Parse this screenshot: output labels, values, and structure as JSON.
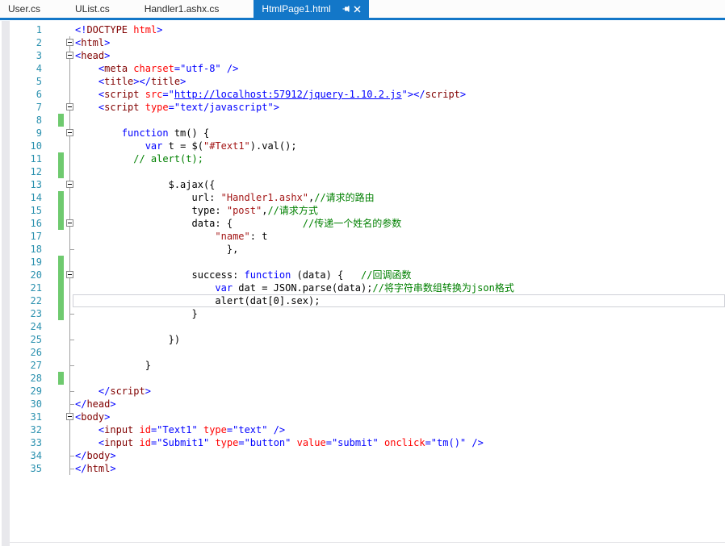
{
  "window": {
    "title": "HtmlPage1.html"
  },
  "colors": {
    "accent": "#1377c8",
    "line_number": "#2b91af",
    "change_bar": "#6fca6f",
    "comment": "#008000",
    "element": "#800000",
    "attribute": "#ff0000",
    "value": "#0000ff",
    "string": "#a31515"
  },
  "tabs": [
    {
      "label": "User.cs",
      "active": false
    },
    {
      "label": "UList.cs",
      "active": false
    },
    {
      "label": "Handler1.ashx.cs",
      "active": false
    },
    {
      "label": "HtmlPage1.html",
      "active": true,
      "icons": [
        "pin-icon",
        "close-icon"
      ]
    }
  ],
  "editor": {
    "current_line": 22,
    "lines": [
      {
        "n": 1,
        "chg": false,
        "fold": "",
        "tokens": [
          [
            "d",
            "<!"
          ],
          [
            "e",
            "DOCTYPE"
          ],
          [
            "t",
            " "
          ],
          [
            "a",
            "html"
          ],
          [
            "d",
            ">"
          ]
        ]
      },
      {
        "n": 2,
        "chg": false,
        "fold": "box",
        "tokens": [
          [
            "d",
            "<"
          ],
          [
            "e",
            "html"
          ],
          [
            "d",
            ">"
          ]
        ]
      },
      {
        "n": 3,
        "chg": false,
        "fold": "box",
        "tokens": [
          [
            "d",
            "<"
          ],
          [
            "e",
            "head"
          ],
          [
            "d",
            ">"
          ]
        ]
      },
      {
        "n": 4,
        "chg": false,
        "fold": "vline",
        "tokens": [
          [
            "t",
            "    "
          ],
          [
            "d",
            "<"
          ],
          [
            "e",
            "meta"
          ],
          [
            "t",
            " "
          ],
          [
            "a",
            "charset"
          ],
          [
            "v",
            "=\"utf-8\""
          ],
          [
            "t",
            " "
          ],
          [
            "d",
            "/>"
          ]
        ]
      },
      {
        "n": 5,
        "chg": false,
        "fold": "vline",
        "tokens": [
          [
            "t",
            "    "
          ],
          [
            "d",
            "<"
          ],
          [
            "e",
            "title"
          ],
          [
            "d",
            "></"
          ],
          [
            "e",
            "title"
          ],
          [
            "d",
            ">"
          ]
        ]
      },
      {
        "n": 6,
        "chg": false,
        "fold": "vline",
        "tokens": [
          [
            "t",
            "    "
          ],
          [
            "d",
            "<"
          ],
          [
            "e",
            "script"
          ],
          [
            "t",
            " "
          ],
          [
            "a",
            "src"
          ],
          [
            "v",
            "=\""
          ],
          [
            "u",
            "http://localhost:57912/jquery-1.10.2.js"
          ],
          [
            "v",
            "\""
          ],
          [
            "d",
            "></"
          ],
          [
            "e",
            "script"
          ],
          [
            "d",
            ">"
          ]
        ]
      },
      {
        "n": 7,
        "chg": false,
        "fold": "box",
        "tokens": [
          [
            "t",
            "    "
          ],
          [
            "d",
            "<"
          ],
          [
            "e",
            "script"
          ],
          [
            "t",
            " "
          ],
          [
            "a",
            "type"
          ],
          [
            "v",
            "=\"text/javascript\""
          ],
          [
            "d",
            ">"
          ]
        ]
      },
      {
        "n": 8,
        "chg": true,
        "fold": "vline",
        "tokens": []
      },
      {
        "n": 9,
        "chg": false,
        "fold": "box",
        "tokens": [
          [
            "t",
            "        "
          ],
          [
            "k",
            "function"
          ],
          [
            "t",
            " tm() {"
          ]
        ]
      },
      {
        "n": 10,
        "chg": false,
        "fold": "vline",
        "tokens": [
          [
            "t",
            "            "
          ],
          [
            "k",
            "var"
          ],
          [
            "t",
            " t = $("
          ],
          [
            "s",
            "\"#Text1\""
          ],
          [
            "t",
            ").val();"
          ]
        ]
      },
      {
        "n": 11,
        "chg": true,
        "fold": "vline",
        "tokens": [
          [
            "t",
            "          "
          ],
          [
            "c",
            "// alert(t);"
          ]
        ]
      },
      {
        "n": 12,
        "chg": true,
        "fold": "vline",
        "tokens": []
      },
      {
        "n": 13,
        "chg": false,
        "fold": "box",
        "tokens": [
          [
            "t",
            "                $.ajax({"
          ]
        ]
      },
      {
        "n": 14,
        "chg": true,
        "fold": "vline",
        "tokens": [
          [
            "t",
            "                    url: "
          ],
          [
            "s",
            "\"Handler1.ashx\""
          ],
          [
            "t",
            ","
          ],
          [
            "c",
            "//请求的路由"
          ]
        ]
      },
      {
        "n": 15,
        "chg": true,
        "fold": "vline",
        "tokens": [
          [
            "t",
            "                    type: "
          ],
          [
            "s",
            "\"post\""
          ],
          [
            "t",
            ","
          ],
          [
            "c",
            "//请求方式"
          ]
        ]
      },
      {
        "n": 16,
        "chg": true,
        "fold": "box",
        "tokens": [
          [
            "t",
            "                    data: {            "
          ],
          [
            "c",
            "//传递一个姓名的参数"
          ]
        ]
      },
      {
        "n": 17,
        "chg": false,
        "fold": "vline",
        "tokens": [
          [
            "t",
            "                        "
          ],
          [
            "s",
            "\"name\""
          ],
          [
            "t",
            ": t"
          ]
        ]
      },
      {
        "n": 18,
        "chg": false,
        "fold": "tick",
        "tokens": [
          [
            "t",
            "                          },"
          ]
        ]
      },
      {
        "n": 19,
        "chg": true,
        "fold": "vline",
        "tokens": []
      },
      {
        "n": 20,
        "chg": true,
        "fold": "box",
        "tokens": [
          [
            "t",
            "                    success: "
          ],
          [
            "k",
            "function"
          ],
          [
            "t",
            " (data) {   "
          ],
          [
            "c",
            "//回调函数"
          ]
        ]
      },
      {
        "n": 21,
        "chg": true,
        "fold": "vline",
        "tokens": [
          [
            "t",
            "                        "
          ],
          [
            "k",
            "var"
          ],
          [
            "t",
            " dat = JSON.parse(data);"
          ],
          [
            "c",
            "//将字符串数组转换为json格式"
          ]
        ]
      },
      {
        "n": 22,
        "chg": true,
        "fold": "vline",
        "tokens": [
          [
            "t",
            "                        alert(dat[0].sex);"
          ]
        ]
      },
      {
        "n": 23,
        "chg": true,
        "fold": "tick",
        "tokens": [
          [
            "t",
            "                    }"
          ]
        ]
      },
      {
        "n": 24,
        "chg": false,
        "fold": "vline",
        "tokens": []
      },
      {
        "n": 25,
        "chg": false,
        "fold": "tick",
        "tokens": [
          [
            "t",
            "                })"
          ]
        ]
      },
      {
        "n": 26,
        "chg": false,
        "fold": "vline",
        "tokens": []
      },
      {
        "n": 27,
        "chg": false,
        "fold": "tick",
        "tokens": [
          [
            "t",
            "            }"
          ]
        ]
      },
      {
        "n": 28,
        "chg": true,
        "fold": "vline",
        "tokens": []
      },
      {
        "n": 29,
        "chg": false,
        "fold": "tick",
        "tokens": [
          [
            "t",
            "    "
          ],
          [
            "d",
            "</"
          ],
          [
            "e",
            "script"
          ],
          [
            "d",
            ">"
          ]
        ]
      },
      {
        "n": 30,
        "chg": false,
        "fold": "tick",
        "tokens": [
          [
            "d",
            "</"
          ],
          [
            "e",
            "head"
          ],
          [
            "d",
            ">"
          ]
        ]
      },
      {
        "n": 31,
        "chg": false,
        "fold": "box",
        "tokens": [
          [
            "d",
            "<"
          ],
          [
            "e",
            "body"
          ],
          [
            "d",
            ">"
          ]
        ]
      },
      {
        "n": 32,
        "chg": false,
        "fold": "vline",
        "tokens": [
          [
            "t",
            "    "
          ],
          [
            "d",
            "<"
          ],
          [
            "e",
            "input"
          ],
          [
            "t",
            " "
          ],
          [
            "a",
            "id"
          ],
          [
            "v",
            "=\"Text1\""
          ],
          [
            "t",
            " "
          ],
          [
            "a",
            "type"
          ],
          [
            "v",
            "=\"text\""
          ],
          [
            "t",
            " "
          ],
          [
            "d",
            "/>"
          ]
        ]
      },
      {
        "n": 33,
        "chg": false,
        "fold": "vline",
        "tokens": [
          [
            "t",
            "    "
          ],
          [
            "d",
            "<"
          ],
          [
            "e",
            "input"
          ],
          [
            "t",
            " "
          ],
          [
            "a",
            "id"
          ],
          [
            "v",
            "=\"Submit1\""
          ],
          [
            "t",
            " "
          ],
          [
            "a",
            "type"
          ],
          [
            "v",
            "=\"button\""
          ],
          [
            "t",
            " "
          ],
          [
            "a",
            "value"
          ],
          [
            "v",
            "=\"submit\""
          ],
          [
            "t",
            " "
          ],
          [
            "a",
            "onclick"
          ],
          [
            "v",
            "=\"tm()\""
          ],
          [
            "t",
            " "
          ],
          [
            "d",
            "/>"
          ]
        ]
      },
      {
        "n": 34,
        "chg": false,
        "fold": "tick",
        "tokens": [
          [
            "d",
            "</"
          ],
          [
            "e",
            "body"
          ],
          [
            "d",
            ">"
          ]
        ]
      },
      {
        "n": 35,
        "chg": false,
        "fold": "tick",
        "tokens": [
          [
            "d",
            "</"
          ],
          [
            "e",
            "html"
          ],
          [
            "d",
            ">"
          ]
        ]
      }
    ]
  }
}
